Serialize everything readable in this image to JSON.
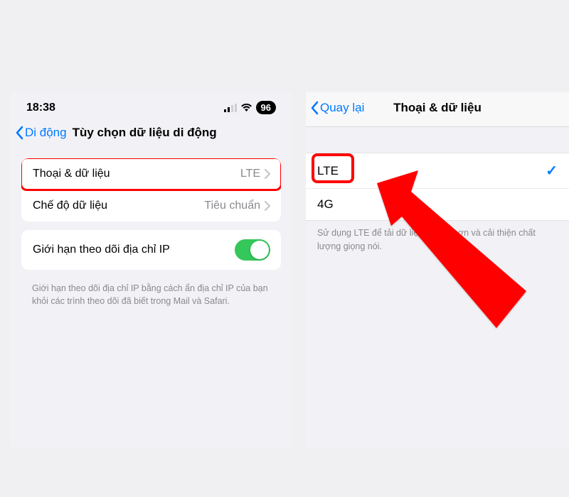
{
  "left": {
    "status": {
      "time": "18:38",
      "battery": "96"
    },
    "nav": {
      "back_label": "Di động",
      "title": "Tùy chọn dữ liệu di động"
    },
    "group1": {
      "row1_label": "Thoại & dữ liệu",
      "row1_value": "LTE",
      "row2_label": "Chế độ dữ liệu",
      "row2_value": "Tiêu chuẩn"
    },
    "group2": {
      "row1_label": "Giới hạn theo dõi địa chỉ IP",
      "footer": "Giới hạn theo dõi địa chỉ IP bằng cách ẩn địa chỉ IP của bạn khỏi các trình theo dõi đã biết trong Mail và Safari."
    }
  },
  "right": {
    "nav": {
      "back_label": "Quay lại",
      "title": "Thoại & dữ liệu"
    },
    "options": {
      "lte_label": "LTE",
      "fourg_label": "4G"
    },
    "description": "Sử dụng LTE để tải dữ liệu nhanh hơn và cải thiện chất lượng giọng nói."
  }
}
